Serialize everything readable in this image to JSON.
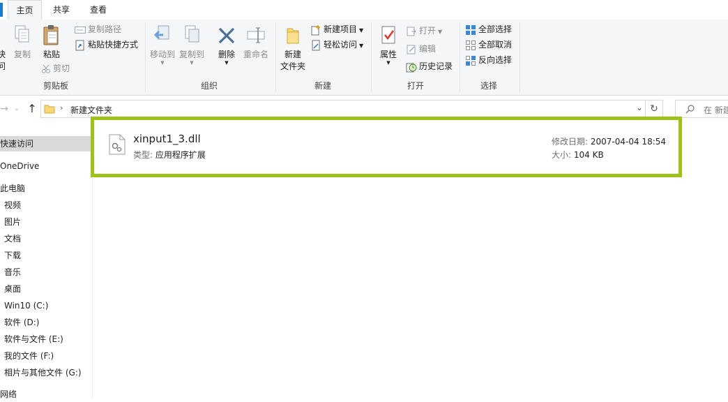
{
  "tabs": {
    "file_strip": "",
    "home": "主页",
    "share": "共享",
    "view": "查看"
  },
  "ribbon": {
    "clipboard": {
      "group_label": "剪贴板",
      "pin_quick_access_partial": "快",
      "pin_quick_access_partial2": "问",
      "copy": "复制",
      "paste": "粘贴",
      "copy_path": "复制路径",
      "paste_shortcut": "粘贴快捷方式",
      "cut": "剪切"
    },
    "organize": {
      "group_label": "组织",
      "move_to": "移动到",
      "copy_to": "复制到",
      "delete": "删除",
      "rename": "重命名"
    },
    "new": {
      "group_label": "新建",
      "new_folder_line1": "新建",
      "new_folder_line2": "文件夹",
      "new_item": "新建项目",
      "easy_access": "轻松访问"
    },
    "open": {
      "group_label": "打开",
      "properties": "属性",
      "open": "打开",
      "edit": "编辑",
      "history": "历史记录"
    },
    "select": {
      "group_label": "选择",
      "select_all": "全部选择",
      "select_none": "全部取消",
      "invert": "反向选择"
    }
  },
  "address": {
    "path": "新建文件夹",
    "search_placeholder": "在 新建"
  },
  "navpane": {
    "items": [
      {
        "label": "快速访问",
        "selected": true
      },
      {
        "label": "OneDrive"
      },
      {
        "label": "此电脑"
      },
      {
        "label": "视频"
      },
      {
        "label": "图片"
      },
      {
        "label": "文档"
      },
      {
        "label": "下载"
      },
      {
        "label": "音乐"
      },
      {
        "label": "桌面"
      },
      {
        "label": "Win10 (C:)"
      },
      {
        "label": "软件 (D:)"
      },
      {
        "label": "软件与文件 (E:)"
      },
      {
        "label": "我的文件 (F:)"
      },
      {
        "label": "相片与其他文件 (G:)"
      },
      {
        "label": "网络"
      }
    ]
  },
  "file": {
    "name": "xinput1_3.dll",
    "type_label": "类型:",
    "type_value": "应用程序扩展",
    "modified_label": "修改日期:",
    "modified_value": "2007-04-04 18:54",
    "size_label": "大小:",
    "size_value": "104 KB"
  },
  "colors": {
    "highlight": "#9dc31b",
    "accent": "#1979ca",
    "folder": "#f8d775"
  }
}
